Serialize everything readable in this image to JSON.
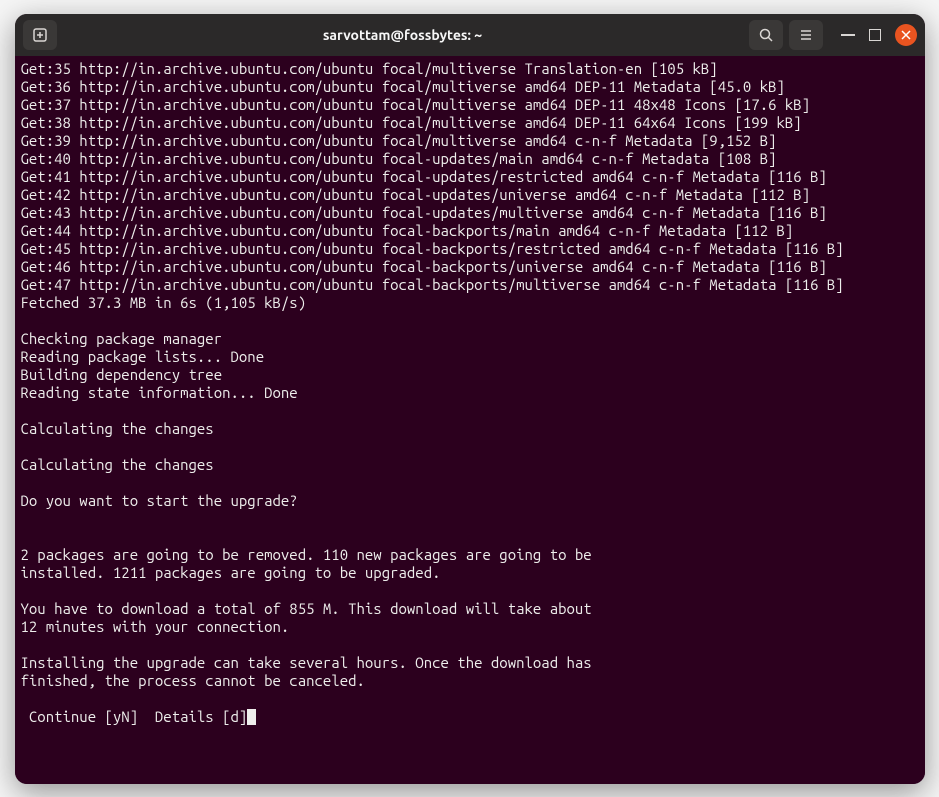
{
  "window": {
    "title": "sarvottam@fossbytes: ~"
  },
  "terminal": {
    "lines": [
      "Get:35 http://in.archive.ubuntu.com/ubuntu focal/multiverse Translation-en [105 kB]",
      "Get:36 http://in.archive.ubuntu.com/ubuntu focal/multiverse amd64 DEP-11 Metadata [45.0 kB]",
      "Get:37 http://in.archive.ubuntu.com/ubuntu focal/multiverse amd64 DEP-11 48x48 Icons [17.6 kB]",
      "Get:38 http://in.archive.ubuntu.com/ubuntu focal/multiverse amd64 DEP-11 64x64 Icons [199 kB]",
      "Get:39 http://in.archive.ubuntu.com/ubuntu focal/multiverse amd64 c-n-f Metadata [9,152 B]",
      "Get:40 http://in.archive.ubuntu.com/ubuntu focal-updates/main amd64 c-n-f Metadata [108 B]",
      "Get:41 http://in.archive.ubuntu.com/ubuntu focal-updates/restricted amd64 c-n-f Metadata [116 B]",
      "Get:42 http://in.archive.ubuntu.com/ubuntu focal-updates/universe amd64 c-n-f Metadata [112 B]",
      "Get:43 http://in.archive.ubuntu.com/ubuntu focal-updates/multiverse amd64 c-n-f Metadata [116 B]",
      "Get:44 http://in.archive.ubuntu.com/ubuntu focal-backports/main amd64 c-n-f Metadata [112 B]",
      "Get:45 http://in.archive.ubuntu.com/ubuntu focal-backports/restricted amd64 c-n-f Metadata [116 B]",
      "Get:46 http://in.archive.ubuntu.com/ubuntu focal-backports/universe amd64 c-n-f Metadata [116 B]",
      "Get:47 http://in.archive.ubuntu.com/ubuntu focal-backports/multiverse amd64 c-n-f Metadata [116 B]",
      "Fetched 37.3 MB in 6s (1,105 kB/s)",
      "",
      "Checking package manager",
      "Reading package lists... Done",
      "Building dependency tree",
      "Reading state information... Done",
      "",
      "Calculating the changes",
      "",
      "Calculating the changes",
      "",
      "Do you want to start the upgrade?",
      "",
      "",
      "2 packages are going to be removed. 110 new packages are going to be",
      "installed. 1211 packages are going to be upgraded.",
      "",
      "You have to download a total of 855 M. This download will take about",
      "12 minutes with your connection.",
      "",
      "Installing the upgrade can take several hours. Once the download has",
      "finished, the process cannot be canceled.",
      ""
    ],
    "prompt": " Continue [yN]  Details [d]"
  }
}
